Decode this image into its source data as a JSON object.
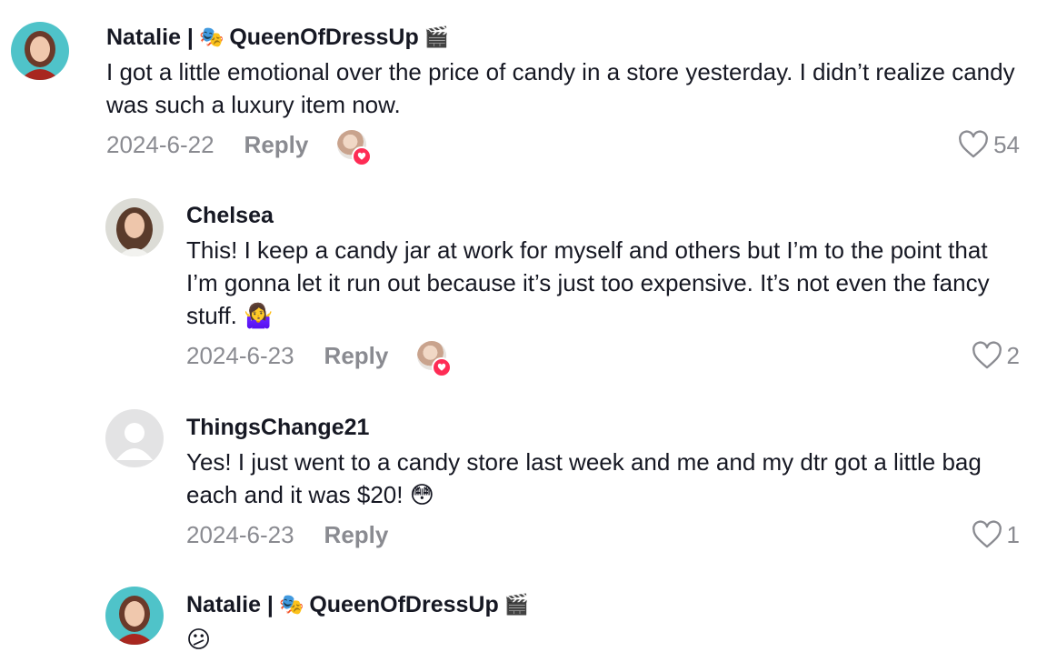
{
  "comments": [
    {
      "username": "Natalie |",
      "username_suffix": "QueenOfDressUp",
      "emoji_pre": "🎭",
      "emoji_post": "🎬",
      "text": "I got a little emotional over the price of candy in a store yesterday. I didn’t realize candy was such a luxury item now.",
      "date": "2024-6-22",
      "reply_label": "Reply",
      "likes": "54",
      "liked_by_creator": true
    },
    {
      "username": "Chelsea",
      "text": "This! I keep a candy jar at work for myself and others but I’m to the point that I’m gonna let it run out because it’s just too expensive. It’s not even the fancy stuff. 🤷‍♀️",
      "date": "2024-6-23",
      "reply_label": "Reply",
      "likes": "2",
      "liked_by_creator": true
    },
    {
      "username": "ThingsChange21",
      "text": "Yes! I just went to a candy store last week and me and my dtr got a little bag each and it was $20! 😳",
      "date": "2024-6-23",
      "reply_label": "Reply",
      "likes": "1",
      "liked_by_creator": false
    },
    {
      "username": "Natalie |",
      "username_suffix": "QueenOfDressUp",
      "emoji_pre": "🎭",
      "emoji_post": "🎬",
      "text": "😕"
    }
  ],
  "icons": {
    "like": "heart-outline-icon",
    "creator_liked": "creator-liked-heart-icon",
    "default_avatar": "default-avatar-icon"
  },
  "colors": {
    "text": "#161823",
    "muted": "#8a8b91",
    "accent": "#fe2c55"
  }
}
